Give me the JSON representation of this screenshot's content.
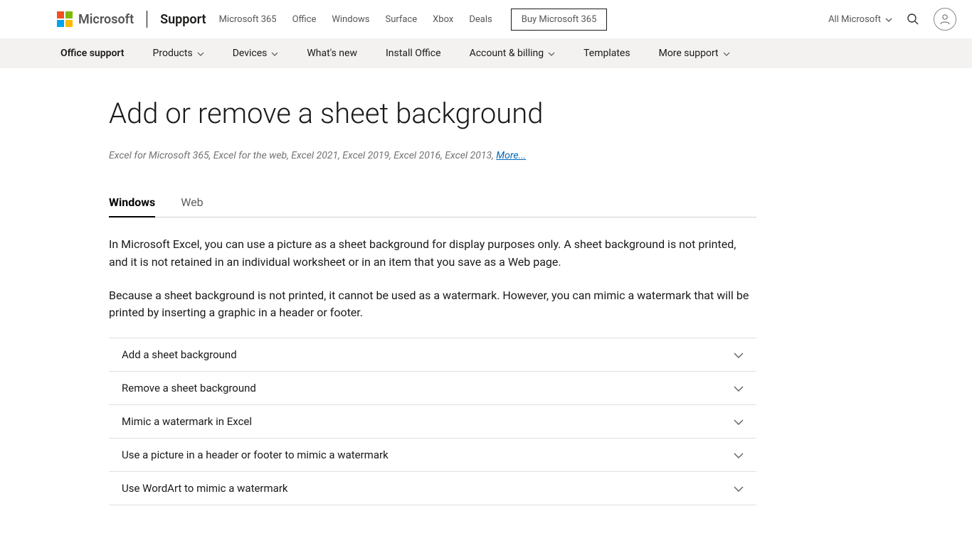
{
  "header": {
    "brand": "Microsoft",
    "site": "Support",
    "top_links": [
      "Microsoft 365",
      "Office",
      "Windows",
      "Surface",
      "Xbox",
      "Deals"
    ],
    "buy_button": "Buy Microsoft 365",
    "all_ms": "All Microsoft"
  },
  "subnav": {
    "items": [
      {
        "label": "Office support",
        "bold": true,
        "chev": false
      },
      {
        "label": "Products",
        "bold": false,
        "chev": true
      },
      {
        "label": "Devices",
        "bold": false,
        "chev": true
      },
      {
        "label": "What's new",
        "bold": false,
        "chev": false
      },
      {
        "label": "Install Office",
        "bold": false,
        "chev": false
      },
      {
        "label": "Account & billing",
        "bold": false,
        "chev": true
      },
      {
        "label": "Templates",
        "bold": false,
        "chev": false
      },
      {
        "label": "More support",
        "bold": false,
        "chev": true
      }
    ]
  },
  "article": {
    "title": "Add or remove a sheet background",
    "applies_to_prefix": "Excel for Microsoft 365, Excel for the web, Excel 2021, Excel 2019, Excel 2016, Excel 2013, ",
    "more": "More...",
    "tabs": [
      "Windows",
      "Web"
    ],
    "active_tab": 0,
    "paragraphs": [
      "In Microsoft Excel, you can use a picture as a sheet background for display purposes only. A sheet background is not printed, and it is not retained in an individual worksheet or in an item that you save as a Web page.",
      "Because a sheet background is not printed, it cannot be used as a watermark. However, you can mimic a watermark that will be printed by inserting a graphic in a header or footer."
    ],
    "accordion": [
      "Add a sheet background",
      "Remove a sheet background",
      "Mimic a watermark in Excel",
      "Use a picture in a header or footer to mimic a watermark",
      "Use WordArt to mimic a watermark"
    ]
  }
}
